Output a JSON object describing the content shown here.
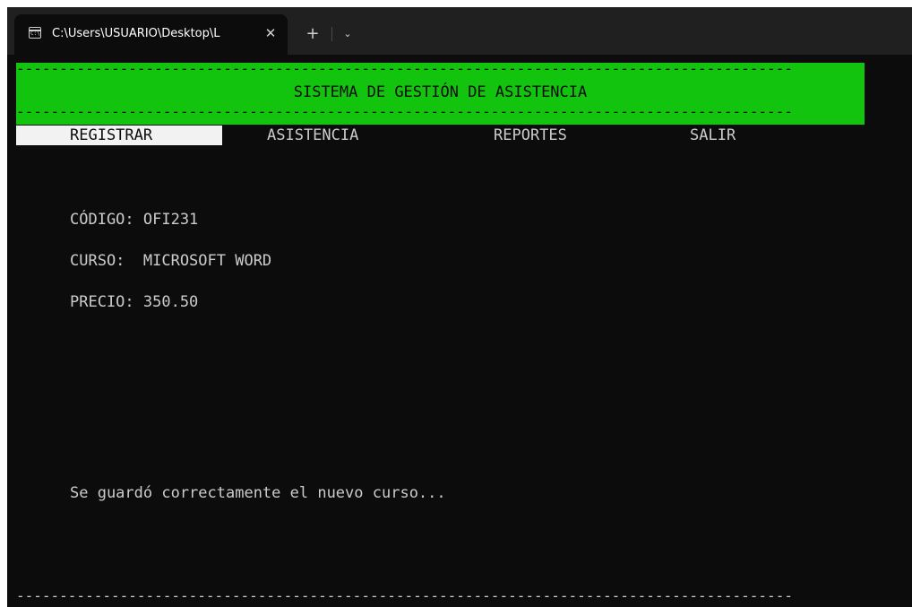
{
  "tab": {
    "icon_text": "C:\\",
    "title": "C:\\Users\\USUARIO\\Desktop\\L",
    "close_symbol": "✕",
    "new_tab_symbol": "+",
    "dropdown_symbol": "⌄"
  },
  "terminal": {
    "dash_line": "------------------------------------------------------------------------------------------",
    "banner_title": "SISTEMA DE GESTIÓN DE ASISTENCIA",
    "menu": [
      {
        "label": "REGISTRAR"
      },
      {
        "label": "ASISTENCIA"
      },
      {
        "label": "REPORTES"
      },
      {
        "label": "SALIR"
      }
    ],
    "fields": {
      "codigo": "CÓDIGO: OFI231",
      "curso": "CURSO:  MICROSOFT WORD",
      "precio": "PRECIO: 350.50"
    },
    "message": "Se guardó correctamente el nuevo curso...",
    "bottom_dash_line": "------------------------------------------------------------------------------------------"
  },
  "colors": {
    "banner_bg": "#13c40f",
    "terminal_bg": "#0c0c0c",
    "text": "#cccccc",
    "selected_bg": "#f2f2f2"
  }
}
